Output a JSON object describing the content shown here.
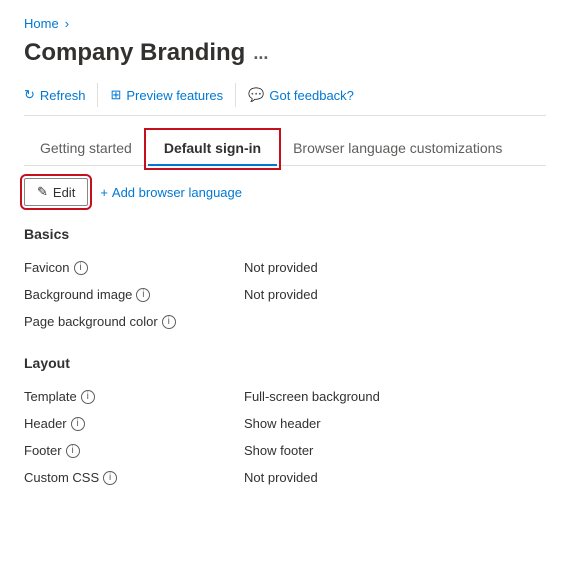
{
  "breadcrumb": {
    "home_label": "Home",
    "separator": "›"
  },
  "page": {
    "title": "Company Branding",
    "ellipsis": "..."
  },
  "toolbar": {
    "refresh_label": "Refresh",
    "refresh_icon": "↻",
    "preview_label": "Preview features",
    "preview_icon": "⊞",
    "feedback_label": "Got feedback?",
    "feedback_icon": "🗨"
  },
  "tabs": [
    {
      "id": "getting-started",
      "label": "Getting started",
      "active": false
    },
    {
      "id": "default-sign-in",
      "label": "Default sign-in",
      "active": true
    },
    {
      "id": "browser-language",
      "label": "Browser language customizations",
      "active": false
    }
  ],
  "actions": {
    "edit_label": "Edit",
    "edit_icon": "✎",
    "add_browser_label": "Add browser language",
    "add_icon": "+"
  },
  "basics": {
    "section_title": "Basics",
    "properties": [
      {
        "label": "Favicon",
        "value": "Not provided",
        "has_info": true
      },
      {
        "label": "Background image",
        "value": "Not provided",
        "has_info": true
      },
      {
        "label": "Page background color",
        "value": "",
        "has_info": true
      }
    ]
  },
  "layout": {
    "section_title": "Layout",
    "properties": [
      {
        "label": "Template",
        "value": "Full-screen background",
        "has_info": true
      },
      {
        "label": "Header",
        "value": "Show header",
        "has_info": true
      },
      {
        "label": "Footer",
        "value": "Show footer",
        "has_info": true
      },
      {
        "label": "Custom CSS",
        "value": "Not provided",
        "has_info": true
      }
    ]
  }
}
